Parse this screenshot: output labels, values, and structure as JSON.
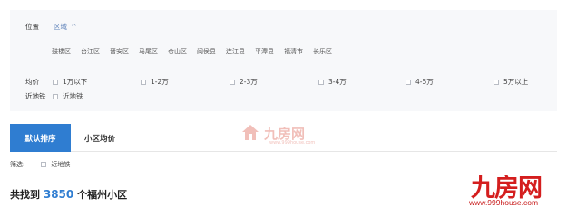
{
  "filters": {
    "location_label": "位置",
    "region_tab": "区域",
    "districts": [
      "鼓楼区",
      "台江区",
      "晋安区",
      "马尾区",
      "仓山区",
      "闽侯县",
      "连江县",
      "平潭县",
      "福清市",
      "长乐区"
    ],
    "price_label": "均价",
    "price_options": [
      "1万以下",
      "1-2万",
      "2-3万",
      "3-4万",
      "4-5万",
      "5万以上"
    ],
    "metro_label": "近地铁",
    "metro_option": "近地铁"
  },
  "tabs": {
    "default_sort": "默认排序",
    "community_price": "小区均价"
  },
  "screening": {
    "label": "筛选:",
    "option": "近地铁"
  },
  "result": {
    "prefix": "共找到",
    "count": "3850",
    "suffix": "个福州小区"
  },
  "watermark": {
    "center_text": "九房网",
    "center_url": "www.999house.com",
    "brand_logo": "九房网",
    "brand_url": "www.999house.com"
  },
  "colors": {
    "accent": "#2f7dd1",
    "brand_red": "#d41e1e",
    "panel_bg": "#f7f8fa"
  }
}
